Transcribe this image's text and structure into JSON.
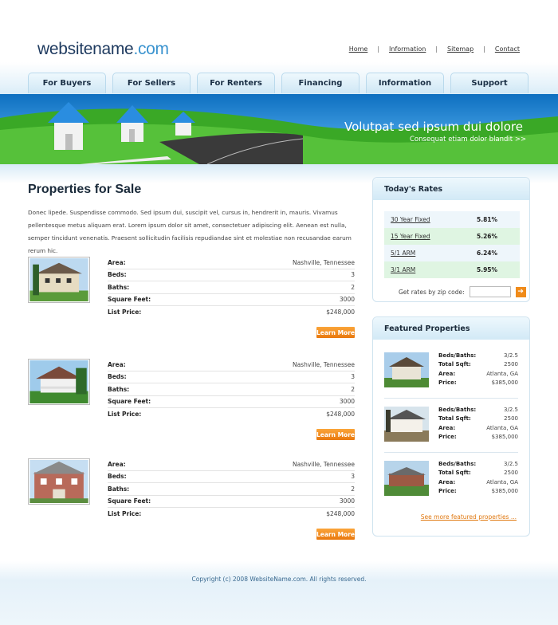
{
  "logo": {
    "part1": "websitename",
    "part2": ".com"
  },
  "toplinks": [
    "Home",
    "Information",
    "Sitemap",
    "Contact"
  ],
  "nav": [
    "For Buyers",
    "For Sellers",
    "For Renters",
    "Financing",
    "Information",
    "Support"
  ],
  "banner": {
    "headline": "Volutpat sed ipsum dui dolore",
    "subline": "Consequat etiam dolor blandit >>"
  },
  "main": {
    "title": "Properties for Sale",
    "intro": "Donec lipede. Suspendisse commodo. Sed ipsum dui, suscipit vel, cursus in, hendrerit in, mauris. Vivamus pellentesque metus aliquam erat. Lorem ipsum dolor sit amet, consectetuer adipiscing elit. Aenean est nulla, semper tincidunt venenatis. Praesent sollicitudin facilisis repudiandae sint et molestiae non recusandae earum rerum hic.",
    "labels": {
      "area": "Area:",
      "beds": "Beds:",
      "baths": "Baths:",
      "sqft": "Square Feet:",
      "price": "List Price:"
    },
    "learn_more": "Learn More",
    "properties": [
      {
        "area": "Nashville, Tennessee",
        "beds": "3",
        "baths": "2",
        "sqft": "3000",
        "price": "$248,000"
      },
      {
        "area": "Nashville, Tennessee",
        "beds": "3",
        "baths": "2",
        "sqft": "3000",
        "price": "$248,000"
      },
      {
        "area": "Nashville, Tennessee",
        "beds": "3",
        "baths": "2",
        "sqft": "3000",
        "price": "$248,000"
      }
    ]
  },
  "rates": {
    "title": "Today's Rates",
    "items": [
      {
        "term": "30 Year Fixed",
        "rate": "5.81%"
      },
      {
        "term": "15 Year Fixed",
        "rate": "5.26%"
      },
      {
        "term": "5/1 ARM",
        "rate": "6.24%"
      },
      {
        "term": "3/1 ARM",
        "rate": "5.95%"
      }
    ],
    "zip_label": "Get rates by zip code:",
    "go": "➔"
  },
  "featured": {
    "title": "Featured Properties",
    "labels": {
      "beds": "Beds/Baths:",
      "sqft": "Total Sqft:",
      "area": "Area:",
      "price": "Price:"
    },
    "items": [
      {
        "beds": "3/2.5",
        "sqft": "2500",
        "area": "Atlanta, GA",
        "price": "$385,000"
      },
      {
        "beds": "3/2.5",
        "sqft": "2500",
        "area": "Atlanta, GA",
        "price": "$385,000"
      },
      {
        "beds": "3/2.5",
        "sqft": "2500",
        "area": "Atlanta, GA",
        "price": "$385,000"
      }
    ],
    "see_more": "See more featured properties ..."
  },
  "footer": {
    "copyright": "Copyright (c) 2008 WebsiteName.com. All rights reserved."
  },
  "colors": {
    "accent": "#f08b1a",
    "nav_text": "#1a2f45",
    "banner": "#1a7fd0",
    "grass": "#3aa826"
  }
}
